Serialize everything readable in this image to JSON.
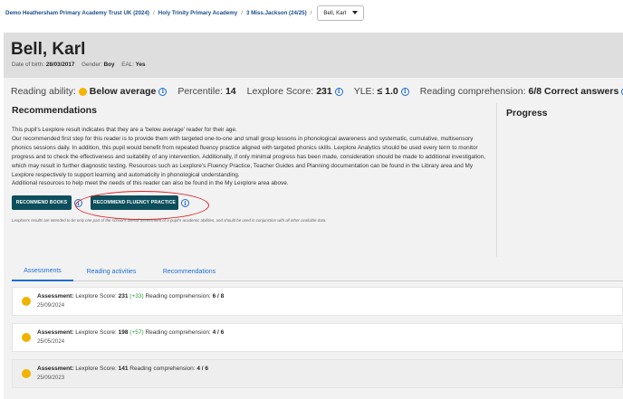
{
  "breadcrumb": {
    "items": [
      "Demo Heathersham Primary Academy Trust UK (2024)",
      "Holy Trinity Primary Academy",
      "3 Miss.Jackson (24/25)"
    ],
    "separator": "/",
    "student_select": "Bell, Karl"
  },
  "pupil": {
    "name": "Bell, Karl",
    "dob_label": "Date of birth:",
    "dob": "28/03/2017",
    "gender_label": "Gender:",
    "gender": "Boy",
    "eal_label": "EAL:",
    "eal": "Yes"
  },
  "metrics": {
    "reading_ability_label": "Reading ability:",
    "reading_ability": "Below average",
    "reading_ability_color": "#f5b400",
    "percentile_label": "Percentile:",
    "percentile": "14",
    "lexplore_label": "Lexplore Score:",
    "lexplore": "231",
    "yle_label": "YLE:",
    "yle": "≤ 1.0",
    "comprehension_label": "Reading comprehension:",
    "comprehension": "6/8 Correct answers"
  },
  "recommendations": {
    "title": "Recommendations",
    "paragraphs": [
      "This pupil's Lexplore result indicates that they are a 'below average' reader for their age.",
      "Our recommended first step for this reader is to provide them with targeted one-to-one and small group lessons in phonological awareness and systematic, cumulative, multisensory phonics sessions daily. In addition, this pupil would benefit from repeated fluency practice aligned with targeted phonics skills. Lexplore Analytics should be used every term to monitor progress and to check the effectiveness and suitability of any intervention. Additionally, if only minimal progress has been made, consideration should be made to additional investigation, which may result in further diagnostic testing. Resources such as Lexplore's Fluency Practice, Teacher Guides and Planning documentation can be found in the Library area and My Lexplore respectively to support learning and automaticity in phonological understanding.",
      "Additional resources to help meet the needs of this reader can also be found in the My Lexplore area above."
    ],
    "btn_books": "RECOMMEND BOOKS",
    "btn_fluency": "RECOMMEND FLUENCY PRACTICE",
    "disclaimer": "Lexplore's results are intended to be only one part of the school's overall assessment of a pupil's academic abilities, and should be used in conjunction with all other available data."
  },
  "progress": {
    "title": "Progress"
  },
  "tabs": [
    "Assessments",
    "Reading activities",
    "Recommendations"
  ],
  "assessments": [
    {
      "label": "Assessment:",
      "score_label": "Lexplore Score:",
      "score": "231",
      "change": "(+33)",
      "comp_label": "Reading comprehension:",
      "comp": "6 / 8",
      "date": "25/09/2024"
    },
    {
      "label": "Assessment:",
      "score_label": "Lexplore Score:",
      "score": "198",
      "change": "(+57)",
      "comp_label": "Reading comprehension:",
      "comp": "4 / 6",
      "date": "25/05/2024"
    },
    {
      "label": "Assessment:",
      "score_label": "Lexplore Score:",
      "score": "141",
      "change": "",
      "comp_label": "Reading comprehension:",
      "comp": "4 / 6",
      "date": "25/09/2023"
    }
  ],
  "colors": {
    "primary_button": "#0d4e5c",
    "link": "#1e6fd0",
    "highlight_circle": "#dd2222",
    "badge": "#f0b400",
    "positive": "#2f9a3e"
  }
}
